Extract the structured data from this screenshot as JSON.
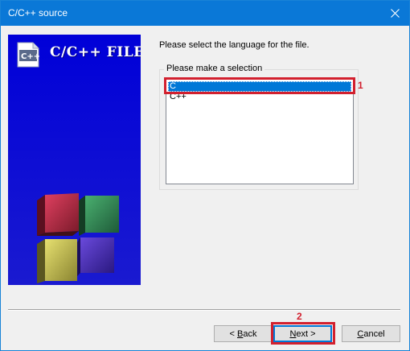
{
  "window": {
    "title": "C/C++ source"
  },
  "banner": {
    "title": "C/C++ FILE",
    "icon_label": "C++"
  },
  "main": {
    "prompt": "Please select the language for the file.",
    "group_label": "Please make a selection",
    "options": [
      "C",
      "C++"
    ],
    "selected": "C"
  },
  "annotations": [
    {
      "number": "1",
      "color": "#d2202e"
    },
    {
      "number": "2",
      "color": "#d2202e"
    }
  ],
  "buttons": {
    "back": {
      "label": "< Back",
      "mnemonic": "B"
    },
    "next": {
      "label": "Next >",
      "mnemonic": "N"
    },
    "cancel": {
      "label": "Cancel",
      "mnemonic": "C"
    }
  },
  "colors": {
    "titlebar": "#0a78d7",
    "banner": "#0000d8",
    "selection": "#0078d7",
    "annotation": "#d2202e"
  }
}
